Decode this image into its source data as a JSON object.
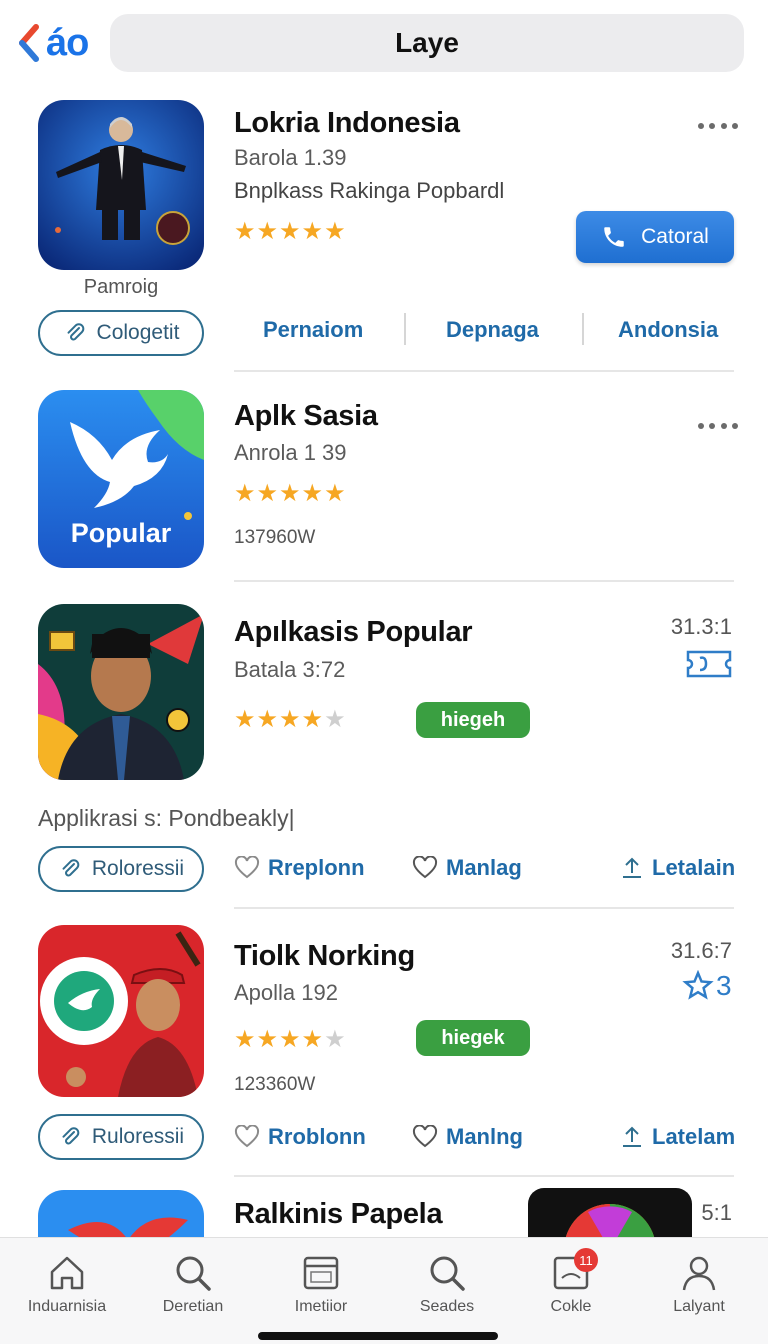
{
  "header": {
    "back_label": "áo",
    "search_title": "Laye"
  },
  "apps": [
    {
      "title": "Lokria Indonesia",
      "subtitle": "Barola 1.39",
      "description": "Bnplkass Rakinga Popbardl",
      "rating": 5,
      "cta_label": "Catoral",
      "icon_caption": "Pamroig",
      "outline_button": "Cologetit",
      "tabs": [
        "Pernaiom",
        "Depnaga",
        "Andonsia"
      ]
    },
    {
      "title": "Aplk Sasia",
      "subtitle": "Anrola 1 39",
      "rating": 4.5,
      "icon_text": "Popular",
      "downloads": "137960W"
    },
    {
      "title": "Apılkasis Popular",
      "subtitle": "Batala 3:72",
      "rating": 4,
      "badge": "hiegeh",
      "side_number": "31.3:1",
      "preview_text": "Applikrasi s: Pondbeakly|",
      "outline_button": "Roloressii",
      "actions": [
        "Rreplonn",
        "Manlag",
        "Letalain"
      ]
    },
    {
      "title": "Tiolk Norking",
      "subtitle": "Apolla 192",
      "rating": 4.5,
      "badge": "hiegek",
      "side_number": "31.6:7",
      "side_icon_text": "3",
      "downloads": "123360W",
      "outline_button": "Ruloressii",
      "actions": [
        "Rroblonn",
        "Manlng",
        "Latelam"
      ]
    },
    {
      "title": "Ralkinis Papela",
      "side_number": "5:1"
    }
  ],
  "bottom_nav": [
    {
      "label": "Induarnisia",
      "icon": "home-icon"
    },
    {
      "label": "Deretian",
      "icon": "search-icon"
    },
    {
      "label": "Imetiior",
      "icon": "calendar-icon"
    },
    {
      "label": "Seades",
      "icon": "search-icon"
    },
    {
      "label": "Cokle",
      "icon": "inbox-icon",
      "badge": "11"
    },
    {
      "label": "Lalyant",
      "icon": "person-icon"
    }
  ],
  "colors": {
    "accent": "#1f6aa8",
    "cta": "#2877d8",
    "badge_green": "#3a9f41",
    "star": "#f6a723",
    "notification": "#e53935"
  }
}
